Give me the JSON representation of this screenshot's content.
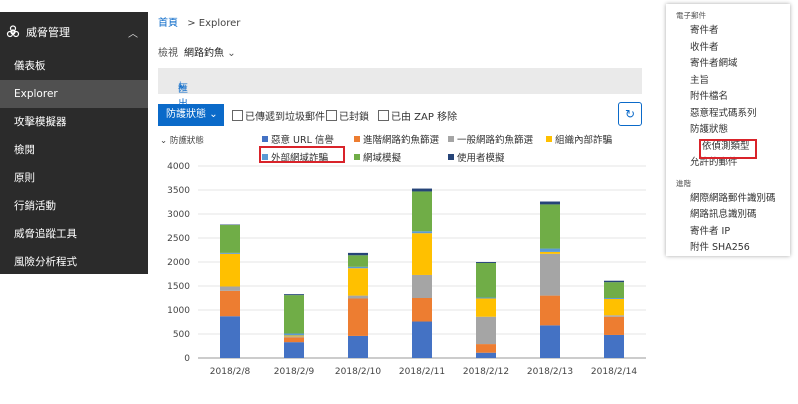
{
  "sidebar": {
    "section": "威脅管理",
    "items": [
      "儀表板",
      "Explorer",
      "攻擊模擬器",
      "檢閱",
      "原則",
      "行銷活動",
      "威脅追蹤工具",
      "風險分析程式"
    ],
    "active": "Explorer"
  },
  "breadcrumb": {
    "home": "首頁",
    "current": "> Explorer"
  },
  "view": {
    "label": "檢視",
    "value": "網路釣魚"
  },
  "export_label": "匯出",
  "toolbar": {
    "dropdown_label": "防護狀態",
    "checkbox1": "已傳遞到垃圾郵件",
    "checkbox2": "已封鎖",
    "checkbox3": "已由 ZAP 移除",
    "refresh_icon": "refresh-icon"
  },
  "legend_title": "防護狀態",
  "legend": [
    "惡意 URL 信譽",
    "進階網路釣魚篩選",
    "一般網路釣魚篩選",
    "組織內部詐騙",
    "外部網域詐騙",
    "網域模擬",
    "使用者模擬"
  ],
  "panel": {
    "section1": "電子郵件",
    "items1": [
      "寄件者",
      "收件者",
      "寄件者網域",
      "主旨",
      "附件檔名",
      "惡意程式碼系列",
      "防護狀態",
      "依偵測類型",
      "允許的郵件"
    ],
    "section2": "進階",
    "items2": [
      "網際網路郵件識別碼",
      "網路訊息識別碼",
      "寄件者 IP",
      "附件 SHA256"
    ]
  },
  "chart_data": {
    "type": "bar",
    "stacked": true,
    "categories": [
      "2018/2/8",
      "2018/2/9",
      "2018/2/10",
      "2018/2/11",
      "2018/2/12",
      "2018/2/13",
      "2018/2/14"
    ],
    "ylim": [
      0,
      4000
    ],
    "yticks": [
      0,
      500,
      1000,
      1500,
      2000,
      2500,
      3000,
      3500,
      4000
    ],
    "series": [
      {
        "name": "惡意 URL 信譽",
        "color": "#4472c4",
        "values": [
          870,
          330,
          460,
          760,
          110,
          680,
          480
        ]
      },
      {
        "name": "進階網路釣魚篩選",
        "color": "#ed7d31",
        "values": [
          530,
          100,
          780,
          490,
          180,
          620,
          380
        ]
      },
      {
        "name": "一般網路釣魚篩選",
        "color": "#a5a5a5",
        "values": [
          90,
          20,
          60,
          480,
          570,
          870,
          30
        ]
      },
      {
        "name": "組織內部詐騙",
        "color": "#ffc000",
        "values": [
          680,
          20,
          570,
          870,
          380,
          40,
          340
        ]
      },
      {
        "name": "外部網域詐騙",
        "color": "#5b9bd5",
        "values": [
          20,
          40,
          30,
          40,
          20,
          70,
          20
        ]
      },
      {
        "name": "網域模擬",
        "color": "#70ad47",
        "values": [
          580,
          800,
          240,
          830,
          720,
          920,
          330
        ]
      },
      {
        "name": "使用者模擬",
        "color": "#264478",
        "values": [
          10,
          20,
          50,
          60,
          20,
          60,
          30
        ]
      }
    ]
  }
}
